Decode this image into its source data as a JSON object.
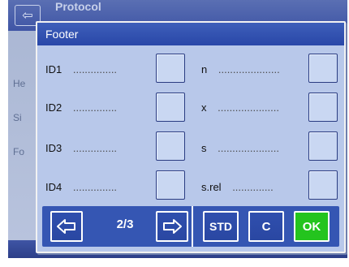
{
  "underlying": {
    "title": "Protocol",
    "back_icon": "back-arrow-icon",
    "items": [
      "He",
      "Si",
      "Fo"
    ]
  },
  "dialog": {
    "title": "Footer",
    "left_rows": [
      {
        "label": "ID1",
        "dots": "...............",
        "value": ""
      },
      {
        "label": "ID2",
        "dots": "...............",
        "value": ""
      },
      {
        "label": "ID3",
        "dots": "...............",
        "value": ""
      },
      {
        "label": "ID4",
        "dots": "...............",
        "value": ""
      }
    ],
    "right_rows": [
      {
        "label": "n",
        "dots": ".....................",
        "value": ""
      },
      {
        "label": "x",
        "dots": ".....................",
        "value": ""
      },
      {
        "label": "s",
        "dots": ".....................",
        "value": ""
      },
      {
        "label": "s.rel",
        "dots": "..............",
        "value": ""
      }
    ]
  },
  "buttons": {
    "prev_icon": "left-arrow-icon",
    "page": "2/3",
    "next_icon": "right-arrow-icon",
    "std": "STD",
    "clear": "C",
    "ok": "OK"
  }
}
